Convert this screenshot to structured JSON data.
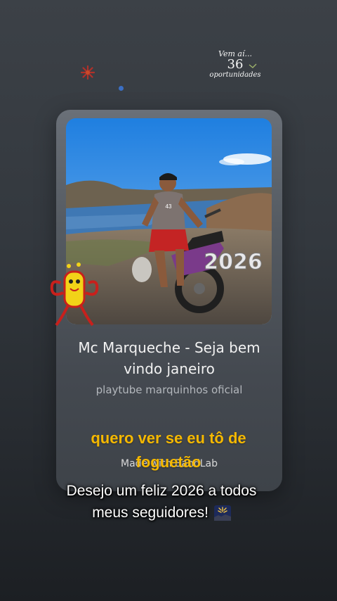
{
  "story_sticker": {
    "line1": "Vem aí...",
    "line2": "36",
    "line3": "oportunidades"
  },
  "card": {
    "cover_year": "2026",
    "title": "Mc Marqueche - Seja bem vindo janeiro",
    "artist": "playtube marquinhos oficial",
    "made_with": "Made with BandLab"
  },
  "lyric": "quero ver se eu tô de foguetão",
  "caption": "Desejo um feliz 2026 a todos meus seguidores!",
  "icons": {
    "firework": "fireworks-emoji-icon",
    "mascot": "red-yellow-mascot-sticker"
  },
  "colors": {
    "lyric": "#f5b800",
    "card": "#555b62"
  }
}
